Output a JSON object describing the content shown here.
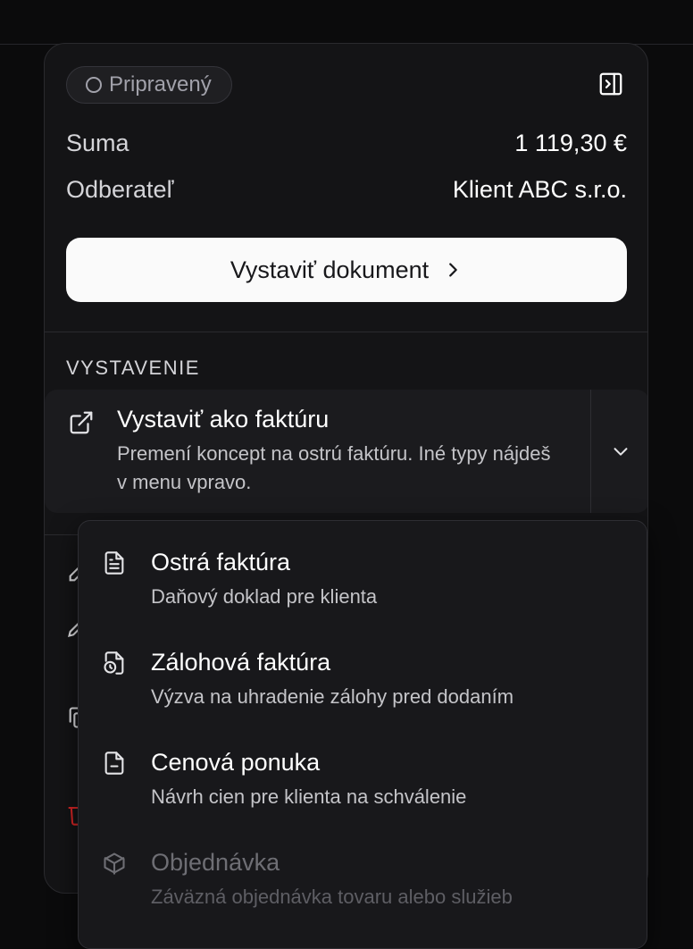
{
  "panel": {
    "status": "Pripravený",
    "summary": {
      "amount_label": "Suma",
      "amount_value": "1 119,30 €",
      "customer_label": "Odberateľ",
      "customer_value": "Klient ABC s.r.o."
    },
    "primary_button": "Vystaviť dokument",
    "section_title": "VYSTAVENIE",
    "issue_option": {
      "title": "Vystaviť ako faktúru",
      "description": "Premení koncept na ostrú faktúru. Iné typy nájdeš v menu vpravo."
    }
  },
  "dropdown": {
    "items": [
      {
        "title": "Ostrá faktúra",
        "description": "Daňový doklad pre klienta",
        "icon": "document-text-icon",
        "disabled": false
      },
      {
        "title": "Zálohová faktúra",
        "description": "Výzva na uhradenie zálohy pred dodaním",
        "icon": "document-clock-icon",
        "disabled": false
      },
      {
        "title": "Cenová ponuka",
        "description": "Návrh cien pre klienta na schválenie",
        "icon": "document-minus-icon",
        "disabled": false
      },
      {
        "title": "Objednávka",
        "description": "Záväzná objednávka tovaru alebo služieb",
        "icon": "package-icon",
        "disabled": true
      }
    ]
  },
  "colors": {
    "background": "#0b0b0c",
    "panel": "#141416",
    "primary_button": "#fafafa",
    "danger": "#dc2626"
  }
}
